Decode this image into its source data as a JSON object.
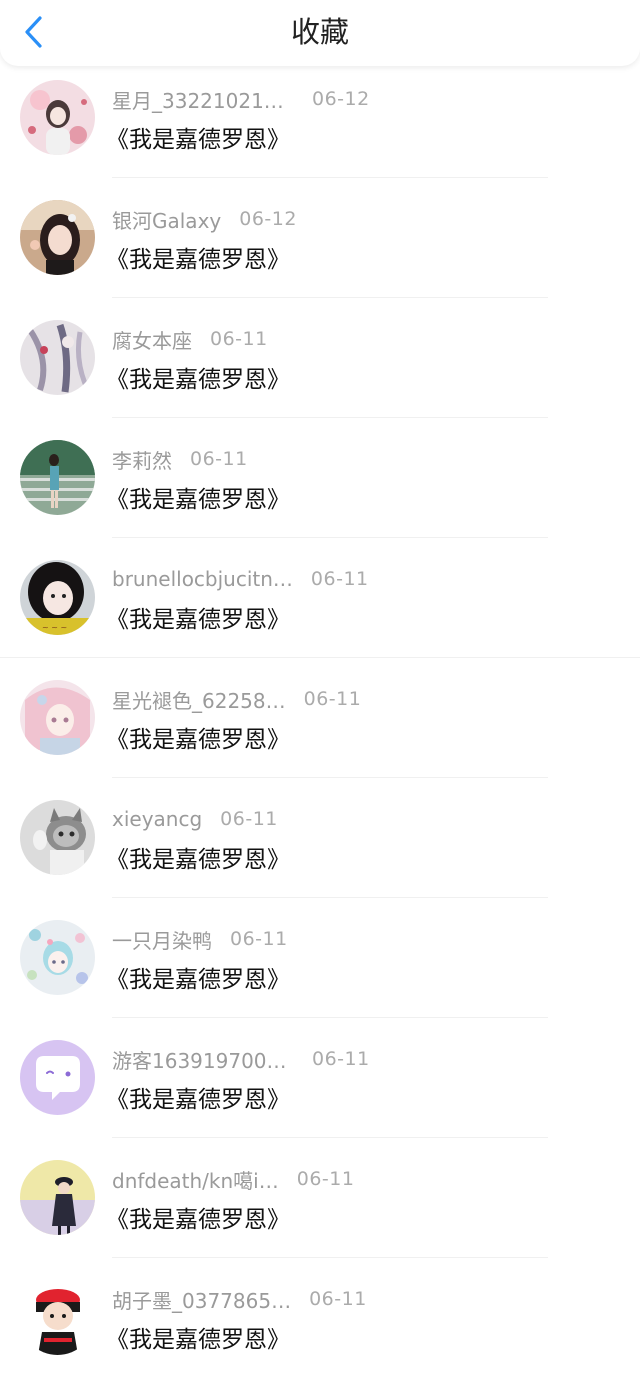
{
  "header": {
    "title": "收藏",
    "back_icon": "chevron-left-icon",
    "accent_color": "#2a8ff7"
  },
  "items": [
    {
      "username": "星月_332210210…",
      "date": "06-12",
      "book": "《我是嘉德罗恩》"
    },
    {
      "username": "银河Galaxy",
      "date": "06-12",
      "book": "《我是嘉德罗恩》"
    },
    {
      "username": "腐女本座",
      "date": "06-11",
      "book": "《我是嘉德罗恩》"
    },
    {
      "username": "李莉然",
      "date": "06-11",
      "book": "《我是嘉德罗恩》"
    },
    {
      "username": "brunellocbjucitn…",
      "date": "06-11",
      "book": "《我是嘉德罗恩》"
    },
    {
      "username": "星光褪色_62258…",
      "date": "06-11",
      "book": "《我是嘉德罗恩》"
    },
    {
      "username": "xieyancg",
      "date": "06-11",
      "book": "《我是嘉德罗恩》"
    },
    {
      "username": "一只月染鸭",
      "date": "06-11",
      "book": "《我是嘉德罗恩》"
    },
    {
      "username": "游客1639197002…",
      "date": "06-11",
      "book": "《我是嘉德罗恩》"
    },
    {
      "username": "dnfdeath/kn噶i…",
      "date": "06-11",
      "book": "《我是嘉德罗恩》"
    },
    {
      "username": "胡子墨_0377865…",
      "date": "06-11",
      "book": "《我是嘉德罗恩》"
    }
  ]
}
